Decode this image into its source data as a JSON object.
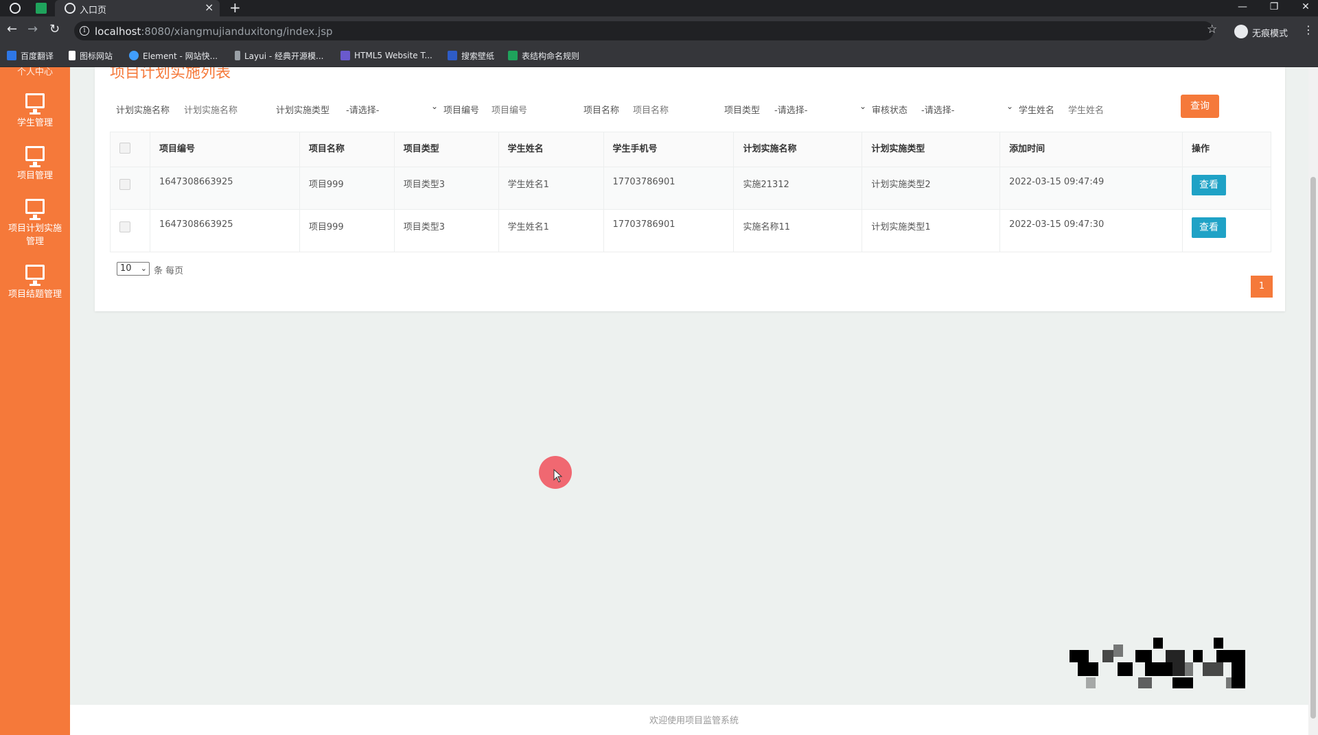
{
  "browser": {
    "tab_title": "入口页",
    "url_host": "localhost",
    "url_rest": ":8080/xiangmujianduxitong/index.jsp",
    "incognito_label": "无痕模式",
    "bookmarks": [
      {
        "label": "百度翻译",
        "color": "#2e77e6"
      },
      {
        "label": "图标网站",
        "color": "#ffffff"
      },
      {
        "label": "Element - 网站快...",
        "color": "#409eff"
      },
      {
        "label": "Layui - 经典开源模...",
        "color": "#9aa0a6"
      },
      {
        "label": "HTML5 Website T...",
        "color": "#6a5acd"
      },
      {
        "label": "搜索壁纸",
        "color": "#2e5cc7"
      },
      {
        "label": "表结构命名规则",
        "color": "#1fa35c"
      }
    ]
  },
  "sidebar": {
    "top_label": "个人中心",
    "items": [
      {
        "label": "学生管理"
      },
      {
        "label": "项目管理"
      },
      {
        "label_line1": "项目计划实施",
        "label_line2": "管理"
      },
      {
        "label": "项目结题管理"
      }
    ]
  },
  "main": {
    "title": "项目计划实施列表",
    "filters": {
      "plan_name_label": "计划实施名称",
      "plan_name_placeholder": "计划实施名称",
      "plan_type_label": "计划实施类型",
      "plan_type_value": "-请选择-",
      "project_no_label": "项目编号",
      "project_no_placeholder": "项目编号",
      "project_name_label": "项目名称",
      "project_name_placeholder": "项目名称",
      "project_type_label": "项目类型",
      "project_type_value": "-请选择-",
      "audit_label": "审核状态",
      "audit_value": "-请选择-",
      "student_name_label": "学生姓名",
      "student_name_placeholder": "学生姓名",
      "search_label": "查询"
    },
    "table": {
      "headers": [
        "项目编号",
        "项目名称",
        "项目类型",
        "学生姓名",
        "学生手机号",
        "计划实施名称",
        "计划实施类型",
        "添加时间",
        "操作"
      ],
      "rows": [
        [
          "1647308663925",
          "项目999",
          "项目类型3",
          "学生姓名1",
          "17703786901",
          "实施21312",
          "计划实施类型2",
          "2022-03-15 09:47:49"
        ],
        [
          "1647308663925",
          "项目999",
          "项目类型3",
          "学生姓名1",
          "17703786901",
          "实施名称11",
          "计划实施类型1",
          "2022-03-15 09:47:30"
        ]
      ],
      "view_label": "查看"
    },
    "pager": {
      "page_size": "10",
      "per_page_label": "条 每页",
      "current_page": "1"
    }
  },
  "footer": {
    "text": "欢迎使用项目监管系统"
  },
  "colors": {
    "accent": "#f5793a",
    "view_button": "#1fa2c6"
  }
}
